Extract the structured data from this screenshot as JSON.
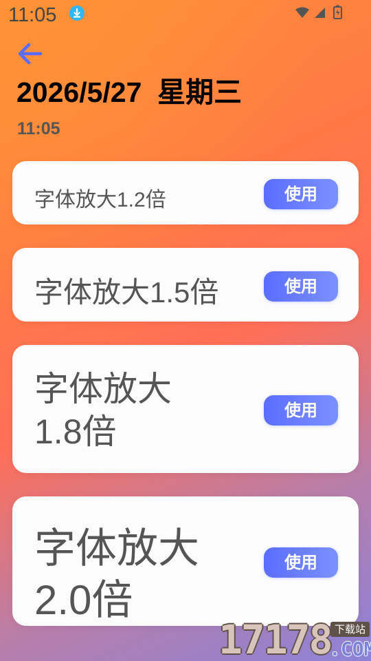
{
  "status_bar": {
    "time": "11:05"
  },
  "header": {
    "date": "2026/5/27  星期三",
    "time": "11:05"
  },
  "options": [
    {
      "label": "字体放大1.2倍",
      "button": "使用"
    },
    {
      "label": "字体放大1.5倍",
      "button": "使用"
    },
    {
      "label": "字体放大1.8倍",
      "button": "使用"
    },
    {
      "label": "字体放大2.0倍",
      "button": "使用"
    }
  ],
  "watermark": {
    "main": "17178",
    "tag": "下载站",
    "com": ".COM"
  },
  "icons": {
    "status": [
      "download-icon",
      "wifi-icon",
      "signal-icon",
      "battery-icon"
    ],
    "navigation": [
      "back-arrow-icon"
    ]
  },
  "colors": {
    "accent": "#5b6dff",
    "back_arrow": "#5a6cff",
    "card_background": "#fcfcfd"
  }
}
